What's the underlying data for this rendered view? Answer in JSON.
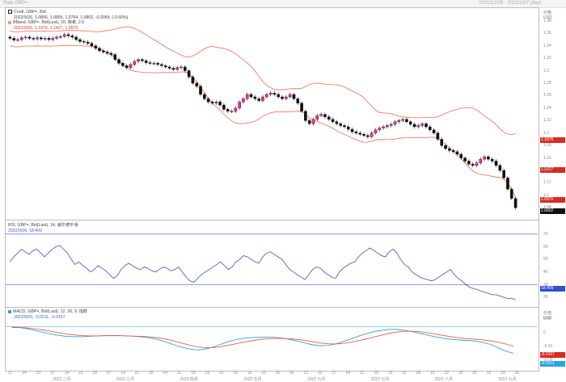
{
  "topbar": {
    "left": "Rate GBP=",
    "right": "2021/12/28 - 2022/10/7 (day)"
  },
  "price_pane": {
    "legend": [
      "Crndl, GBP=, Bid",
      "2022/9/26, 1.0856, 1.0856, 1.0764, 1.0802, -0.0054, (-0.50%)",
      "BBand, GBP=, Bid(Last), 20, 简单, 2.0",
      "2022/9/26, 1.1876, 1.1427, 1.0975"
    ],
    "axis_header": [
      "价格",
      "USD"
    ],
    "y_ticks": [
      "1.38",
      "1.36",
      "1.34",
      "1.32",
      "1.3",
      "1.28",
      "1.26",
      "1.24",
      "1.22",
      "1.2",
      "1.18",
      "1.16",
      "1.14",
      "1.12",
      "1.1",
      "1.08"
    ],
    "tags": [
      {
        "text": "1.1876",
        "color": "#d62d20"
      },
      {
        "text": "1.1427",
        "color": "#d62d20"
      },
      {
        "text": "1.0975",
        "color": "#d62d20"
      },
      {
        "text": "1.0802",
        "color": "#111111"
      }
    ]
  },
  "rsi_pane": {
    "legend": [
      "RSI, GBP=, Bid(Last), 14, 威尔德平滑",
      "2022/9/26, 18.409"
    ],
    "y_ticks": [
      "70",
      "60",
      "50",
      "40",
      "30",
      "20"
    ],
    "tag": {
      "text": "18.409",
      "color": "#2d4fd0"
    }
  },
  "macd_pane": {
    "legend": [
      "MACD, GBP=, Bid(Last), 12, 26, 9, 指数",
      "2022/9/26, -0.0211, -0.0157"
    ],
    "axis_header": [
      "价值",
      "USD"
    ],
    "y_ticks": [
      "0.01",
      "0",
      "-0.01",
      "-0.02"
    ],
    "tags": [
      {
        "text": "-0.0157",
        "color": "#d62d20"
      },
      {
        "text": "-0.0211",
        "color": "#2aa3e0"
      }
    ]
  },
  "x_axis": {
    "days": [
      "17",
      "24",
      "31",
      "07",
      "14",
      "21",
      "28",
      "07",
      "14",
      "21",
      "28",
      "04",
      "11",
      "18",
      "25",
      "02",
      "09",
      "16",
      "23",
      "30",
      "06",
      "13",
      "20",
      "27",
      "04",
      "11",
      "18",
      "25",
      "01",
      "08",
      "15",
      "22",
      "29",
      "05",
      "12",
      "19",
      "26"
    ],
    "months": [
      "2022 二月",
      "2022 三月",
      "2022 四月",
      "2022 五月",
      "2022 六月",
      "2022 七月",
      "2022 八月",
      "2022 九月"
    ]
  },
  "chart_data": [
    {
      "type": "candlestick",
      "title": "Crndl, GBP=, Bid",
      "ylim": [
        1.07,
        1.385
      ],
      "close": [
        1.352,
        1.349,
        1.35,
        1.353,
        1.354,
        1.352,
        1.351,
        1.353,
        1.351,
        1.352,
        1.35,
        1.352,
        1.354,
        1.355,
        1.358,
        1.356,
        1.354,
        1.35,
        1.347,
        1.346,
        1.344,
        1.34,
        1.336,
        1.332,
        1.33,
        1.328,
        1.326,
        1.318,
        1.312,
        1.308,
        1.305,
        1.31,
        1.315,
        1.318,
        1.316,
        1.313,
        1.312,
        1.312,
        1.31,
        1.308,
        1.306,
        1.304,
        1.302,
        1.305,
        1.306,
        1.3,
        1.29,
        1.28,
        1.275,
        1.262,
        1.255,
        1.25,
        1.248,
        1.25,
        1.245,
        1.238,
        1.235,
        1.235,
        1.24,
        1.25,
        1.255,
        1.262,
        1.258,
        1.255,
        1.252,
        1.258,
        1.262,
        1.264,
        1.262,
        1.258,
        1.255,
        1.258,
        1.262,
        1.255,
        1.248,
        1.235,
        1.22,
        1.215,
        1.222,
        1.228,
        1.23,
        1.226,
        1.222,
        1.218,
        1.215,
        1.212,
        1.21,
        1.206,
        1.202,
        1.2,
        1.198,
        1.196,
        1.194,
        1.2,
        1.205,
        1.208,
        1.21,
        1.212,
        1.214,
        1.218,
        1.22,
        1.222,
        1.218,
        1.214,
        1.21,
        1.212,
        1.215,
        1.21,
        1.205,
        1.2,
        1.19,
        1.18,
        1.175,
        1.172,
        1.17,
        1.166,
        1.16,
        1.155,
        1.15,
        1.148,
        1.152,
        1.158,
        1.162,
        1.158,
        1.155,
        1.148,
        1.14,
        1.128,
        1.11,
        1.095,
        1.08
      ]
    },
    {
      "type": "line",
      "title": "RSI, GBP=, Bid(Last), 14, 威尔德平滑",
      "ylim": [
        15,
        75
      ],
      "values": [
        48,
        52,
        55,
        58,
        56,
        54,
        57,
        58,
        55,
        52,
        55,
        58,
        60,
        61,
        58,
        55,
        50,
        46,
        48,
        45,
        43,
        40,
        42,
        45,
        43,
        41,
        38,
        35,
        37,
        42,
        45,
        47,
        45,
        43,
        42,
        44,
        43,
        41,
        40,
        42,
        44,
        43,
        41,
        42,
        44,
        40,
        36,
        33,
        32,
        35,
        38,
        40,
        42,
        44,
        46,
        48,
        45,
        42,
        44,
        48,
        50,
        53,
        52,
        50,
        48,
        47,
        52,
        55,
        56,
        54,
        52,
        50,
        46,
        42,
        40,
        38,
        36,
        34,
        38,
        42,
        44,
        43,
        40,
        38,
        36,
        35,
        40,
        43,
        45,
        47,
        48,
        52,
        55,
        57,
        59,
        57,
        55,
        53,
        52,
        56,
        58,
        55,
        50,
        46,
        44,
        40,
        38,
        36,
        35,
        34,
        33,
        34,
        36,
        38,
        40,
        42,
        38,
        35,
        33,
        30,
        28,
        27,
        26,
        25,
        24,
        23,
        22,
        22,
        21,
        20,
        19,
        19,
        18.4
      ]
    },
    {
      "type": "line",
      "title": "MACD, GBP=, Bid(Last), 12, 26, 9, 指数",
      "ylim": [
        -0.026,
        0.012
      ],
      "series": [
        {
          "values": [
            0.0045,
            0.004,
            0.003,
            0.0018,
            0.0005,
            -0.0008,
            -0.0018,
            -0.0025,
            -0.0028,
            -0.0028,
            -0.0025,
            -0.0022,
            -0.002,
            -0.0019,
            -0.002,
            -0.0022,
            -0.0025,
            -0.003,
            -0.0038,
            -0.005,
            -0.0068,
            -0.0088,
            -0.0105,
            -0.0118,
            -0.0125,
            -0.012,
            -0.0105,
            -0.0085,
            -0.0065,
            -0.005,
            -0.004,
            -0.0035,
            -0.0032,
            -0.003,
            -0.0032,
            -0.0038,
            -0.0048,
            -0.006,
            -0.0075,
            -0.0088,
            -0.0095,
            -0.0092,
            -0.008,
            -0.0062,
            -0.0042,
            -0.0022,
            -0.0005,
            0.001,
            0.002,
            0.0026,
            0.0025,
            0.0018,
            0.0008,
            -0.0005,
            -0.0018,
            -0.003,
            -0.004,
            -0.0048,
            -0.0052,
            -0.0055,
            -0.006,
            -0.007,
            -0.0085,
            -0.011,
            -0.0135,
            -0.015
          ]
        },
        {
          "values": [
            0.004,
            0.004,
            0.0036,
            0.003,
            0.0022,
            0.0012,
            0.0002,
            -0.0008,
            -0.0015,
            -0.002,
            -0.0022,
            -0.0022,
            -0.0021,
            -0.0021,
            -0.0021,
            -0.0022,
            -0.0024,
            -0.0026,
            -0.003,
            -0.0036,
            -0.0046,
            -0.006,
            -0.0075,
            -0.009,
            -0.0102,
            -0.0108,
            -0.0108,
            -0.0102,
            -0.0092,
            -0.008,
            -0.0068,
            -0.0058,
            -0.005,
            -0.0044,
            -0.0041,
            -0.0041,
            -0.0043,
            -0.0048,
            -0.0056,
            -0.0065,
            -0.0074,
            -0.008,
            -0.0081,
            -0.0077,
            -0.0068,
            -0.0056,
            -0.0043,
            -0.0029,
            -0.0015,
            -0.0002,
            0.0008,
            0.0012,
            0.0012,
            0.0008,
            0.0,
            -0.001,
            -0.002,
            -0.0029,
            -0.0036,
            -0.0042,
            -0.0046,
            -0.0051,
            -0.0058,
            -0.0068,
            -0.0082,
            -0.0098
          ]
        }
      ]
    }
  ]
}
